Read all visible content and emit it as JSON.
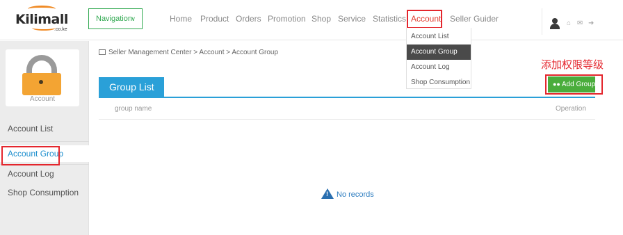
{
  "logo": {
    "name": "Kilimall",
    "suffix": ".co.ke"
  },
  "nav": {
    "navigation_label": "Navigation",
    "items": [
      {
        "label": "Home"
      },
      {
        "label": "Product"
      },
      {
        "label": "Orders"
      },
      {
        "label": "Promotion"
      },
      {
        "label": "Shop"
      },
      {
        "label": "Service"
      },
      {
        "label": "Statistics"
      },
      {
        "label": "Account"
      },
      {
        "label": "Seller Guider"
      }
    ]
  },
  "dropdown": [
    "Account List",
    "Account Group",
    "Account Log",
    "Shop Consumption"
  ],
  "sidebar": {
    "card_caption": "Account",
    "items": [
      {
        "label": "Account List"
      },
      {
        "label": "Account Group"
      },
      {
        "label": "Account Log"
      },
      {
        "label": "Shop Consumption"
      }
    ]
  },
  "breadcrumb": "Seller Management Center > Account > Account Group",
  "annotation": "添加权限等级",
  "main": {
    "tab": "Group List",
    "add_button": "Add Group",
    "columns": [
      "group name",
      "Operation"
    ],
    "empty_text": "No records"
  },
  "colors": {
    "accent_blue": "#2aa0d8",
    "green": "#4aad3c",
    "annotation_red": "#e4262d"
  }
}
